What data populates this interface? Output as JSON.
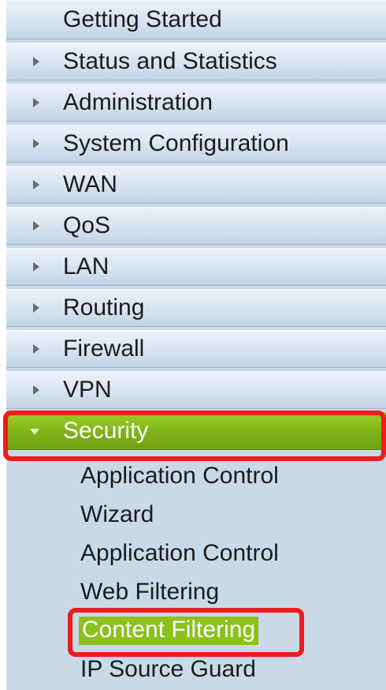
{
  "menu": {
    "items": [
      {
        "label": "Getting Started",
        "arrow": "none"
      },
      {
        "label": "Status and Statistics",
        "arrow": "collapsed"
      },
      {
        "label": "Administration",
        "arrow": "collapsed"
      },
      {
        "label": "System Configuration",
        "arrow": "collapsed"
      },
      {
        "label": "WAN",
        "arrow": "collapsed"
      },
      {
        "label": "QoS",
        "arrow": "collapsed"
      },
      {
        "label": "LAN",
        "arrow": "collapsed"
      },
      {
        "label": "Routing",
        "arrow": "collapsed"
      },
      {
        "label": "Firewall",
        "arrow": "collapsed"
      },
      {
        "label": "VPN",
        "arrow": "collapsed"
      },
      {
        "label": "Security",
        "arrow": "expanded",
        "active": true
      }
    ],
    "security_subitems": [
      {
        "label": "Application Control"
      },
      {
        "label": "Wizard"
      },
      {
        "label": "Application Control"
      },
      {
        "label": "Web Filtering"
      },
      {
        "label": "Content Filtering",
        "selected": true
      },
      {
        "label": "IP Source Guard"
      }
    ]
  },
  "colors": {
    "active_item": "#7fb21a",
    "selected_subitem": "#8cc11d",
    "highlight_outline": "#ee1c1c",
    "menu_background": "#c9d9e8"
  },
  "icons": {
    "collapsed": "arrow-right-icon",
    "expanded": "arrow-down-icon"
  }
}
